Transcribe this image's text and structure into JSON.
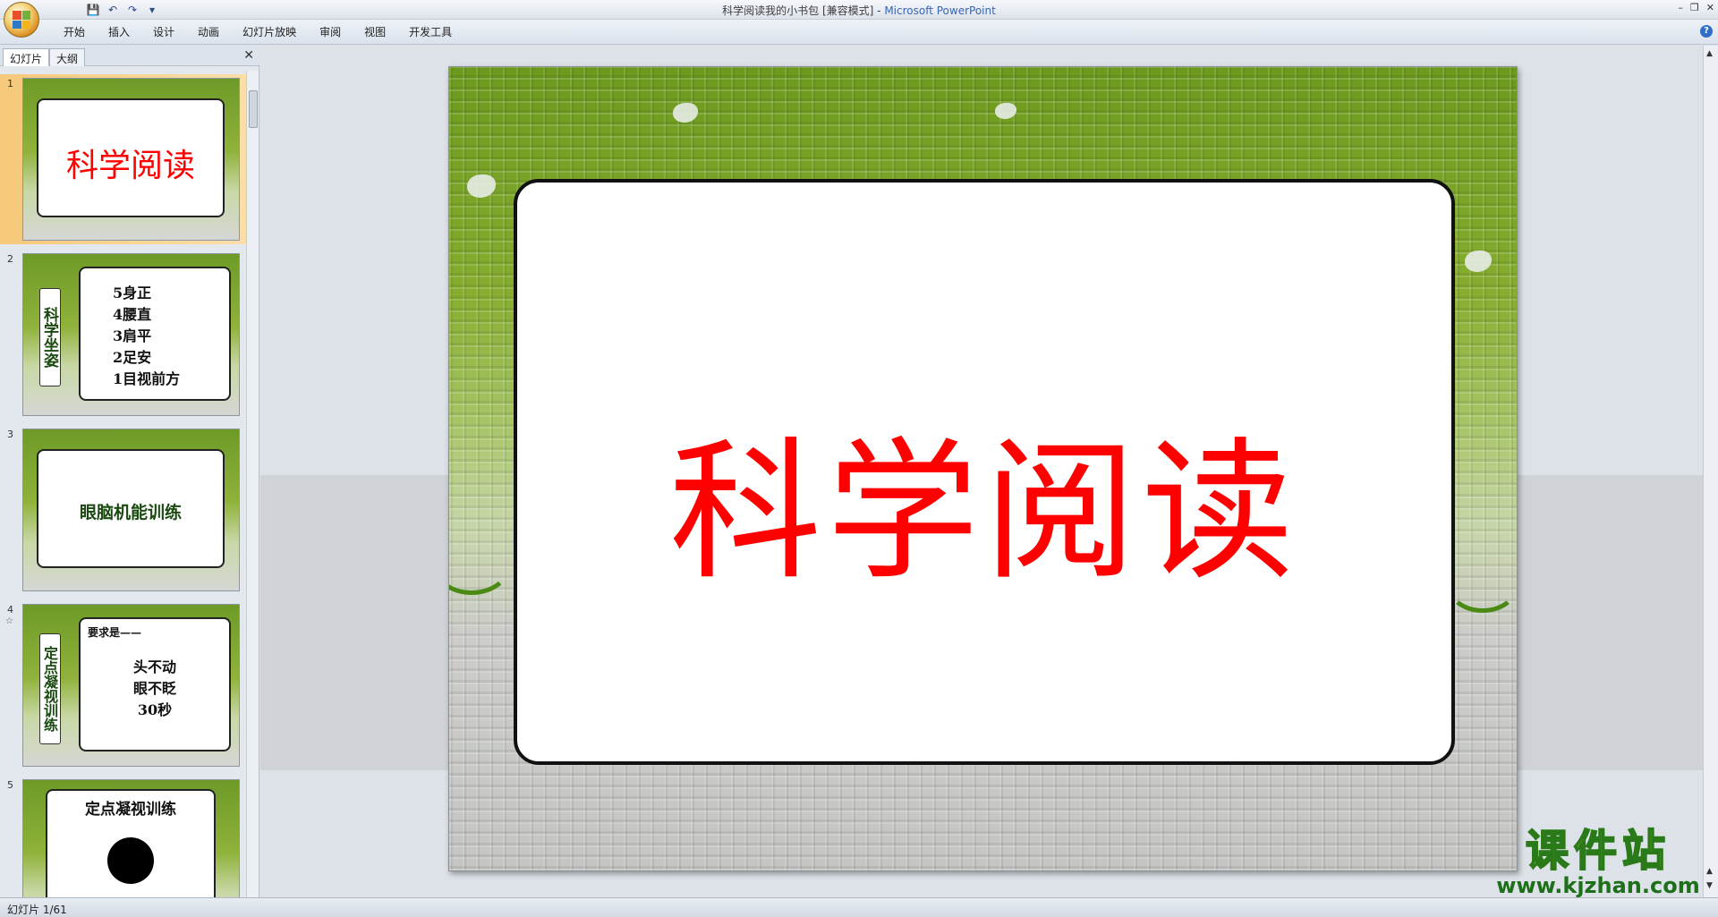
{
  "window": {
    "title_doc": "科学阅读我的小书包 [兼容模式]",
    "title_sep": " - ",
    "title_app": "Microsoft PowerPoint",
    "controls": [
      "–",
      "❐",
      "✕"
    ]
  },
  "qat": {
    "save": "💾",
    "undo": "↶",
    "redo": "↷",
    "more": "▾"
  },
  "ribbon": {
    "tabs": [
      "开始",
      "插入",
      "设计",
      "动画",
      "幻灯片放映",
      "审阅",
      "视图",
      "开发工具"
    ],
    "help": "?"
  },
  "panel": {
    "tabs": [
      "幻灯片",
      "大纲"
    ],
    "close": "✕",
    "slides": [
      {
        "num": "1",
        "title": "科学阅读"
      },
      {
        "num": "2",
        "label": "科学坐姿",
        "lines": [
          "5身正",
          "4腰直",
          "3肩平",
          "2足安",
          "1目视前方"
        ]
      },
      {
        "num": "3",
        "title": "眼脑机能训练"
      },
      {
        "num": "4",
        "star": "☆",
        "label": "定点凝视训练",
        "heading": "要求是——",
        "lines": [
          "头不动",
          "眼不眨",
          "30秒"
        ]
      },
      {
        "num": "5",
        "title": "定点凝视训练"
      }
    ]
  },
  "slide": {
    "title": "科学阅读"
  },
  "status": {
    "text": "幻灯片 1/61"
  },
  "watermark": {
    "cn": "课件站",
    "url": "www.kjzhan.com"
  },
  "colors": {
    "title_red": "#ff0000",
    "slide_green": "#6c9a1e",
    "selected_thumb": "#f6c87a"
  }
}
